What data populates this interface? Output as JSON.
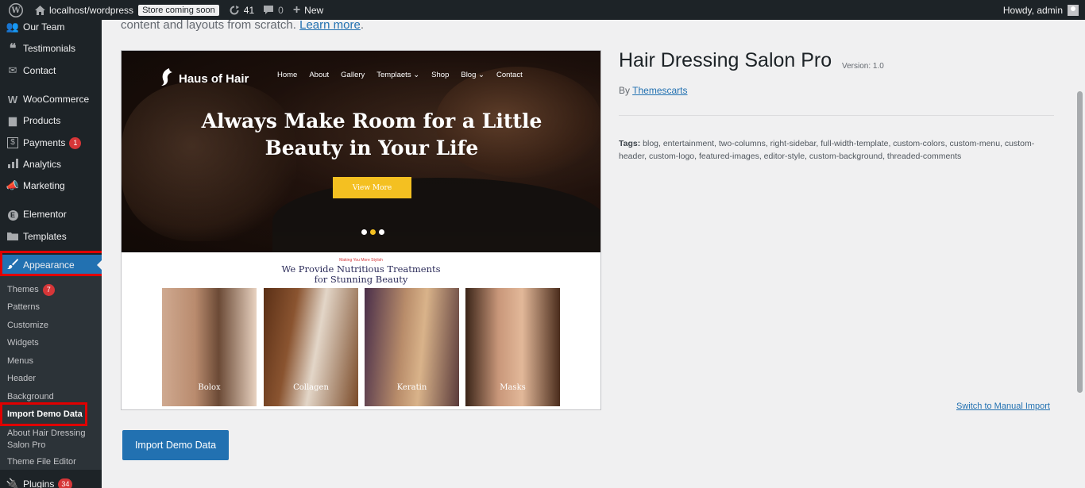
{
  "adminbar": {
    "site_name": "localhost/wordpress",
    "store_badge": "Store coming soon",
    "updates_count": "41",
    "comments_count": "0",
    "new_label": "New",
    "howdy": "Howdy, admin"
  },
  "sidebar": {
    "items": [
      {
        "label": "Our Team",
        "icon": "group-icon"
      },
      {
        "label": "Testimonials",
        "icon": "quote-icon"
      },
      {
        "label": "Contact",
        "icon": "mail-icon"
      },
      {
        "label": "WooCommerce",
        "icon": "woo-icon"
      },
      {
        "label": "Products",
        "icon": "archive-icon"
      },
      {
        "label": "Payments",
        "icon": "dollar-icon",
        "count": "1"
      },
      {
        "label": "Analytics",
        "icon": "bar-chart-icon"
      },
      {
        "label": "Marketing",
        "icon": "megaphone-icon"
      },
      {
        "label": "Elementor",
        "icon": "elementor-icon"
      },
      {
        "label": "Templates",
        "icon": "folder-icon"
      },
      {
        "label": "Appearance",
        "icon": "brush-icon"
      },
      {
        "label": "Plugins",
        "icon": "plugin-icon",
        "count": "34"
      }
    ],
    "submenu": [
      {
        "label": "Themes",
        "count": "7"
      },
      {
        "label": "Patterns"
      },
      {
        "label": "Customize"
      },
      {
        "label": "Widgets"
      },
      {
        "label": "Menus"
      },
      {
        "label": "Header"
      },
      {
        "label": "Background"
      },
      {
        "label": "Import Demo Data"
      },
      {
        "label": "About Hair Dressing Salon Pro"
      },
      {
        "label": "Theme File Editor"
      }
    ]
  },
  "main": {
    "intro_text": "content and layouts from scratch.",
    "intro_link": "Learn more",
    "theme_name": "Hair Dressing Salon Pro",
    "version": "Version: 1.0",
    "by_label": "By",
    "author": "Themescarts",
    "tags_label": "Tags:",
    "tags": "blog, entertainment, two-columns, right-sidebar, full-width-template, custom-colors, custom-menu, custom-header, custom-logo, featured-images, editor-style, custom-background, threaded-comments",
    "switch_link": "Switch to Manual Import",
    "import_button": "Import Demo Data"
  },
  "preview": {
    "logo": "Haus of Hair",
    "nav": [
      "Home",
      "About",
      "Gallery",
      "Templaets ⌄",
      "Shop",
      "Blog ⌄",
      "Contact"
    ],
    "hero_line1": "Always Make Room for a Little",
    "hero_line2": "Beauty in Your Life",
    "hero_button": "View More",
    "eyebrow": "Making You More Stylish",
    "section_line1": "We Provide Nutritious Treatments",
    "section_line2": "for Stunning Beauty",
    "cards": [
      "Bolox",
      "Collagen",
      "Keratin",
      "Masks"
    ]
  }
}
